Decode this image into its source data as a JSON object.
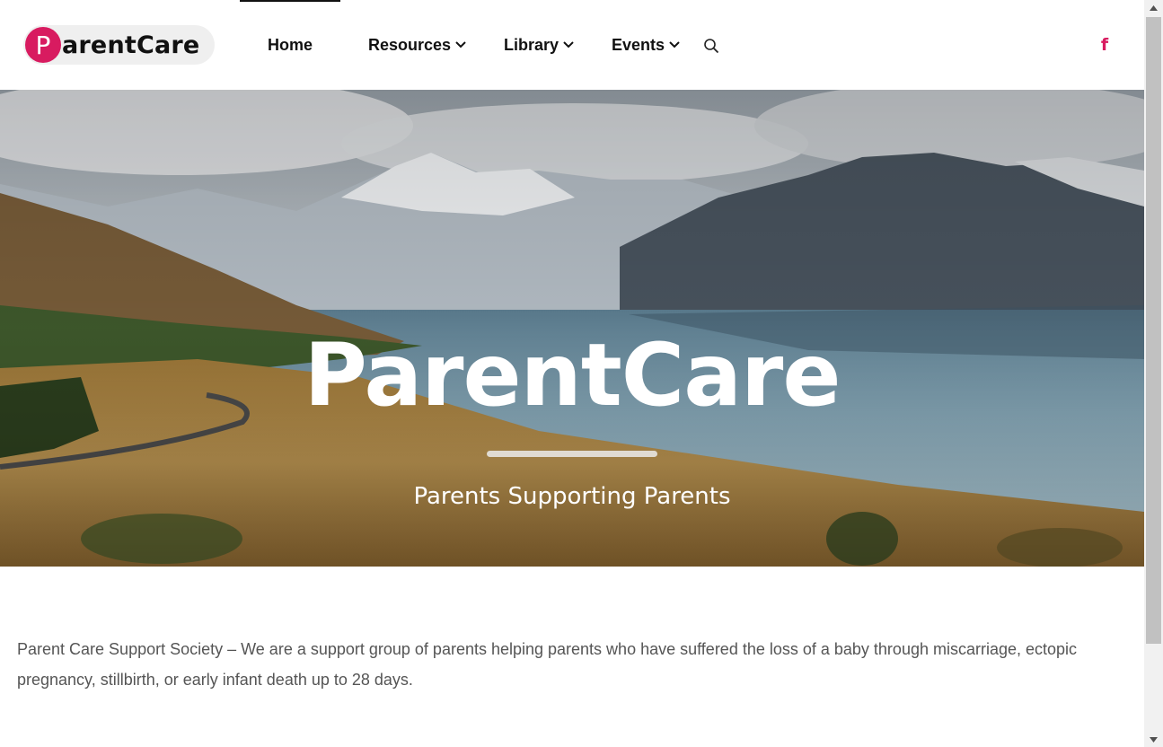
{
  "header": {
    "logo_letter": "P",
    "logo_text": "arentCare",
    "nav": [
      {
        "label": "Home"
      },
      {
        "label": "Resources"
      },
      {
        "label": "Library"
      },
      {
        "label": "Events"
      }
    ],
    "search_icon": "search-icon",
    "social_icon": "facebook-icon",
    "social_glyph": "f"
  },
  "hero": {
    "title": "ParentCare",
    "subtitle": "Parents Supporting Parents"
  },
  "intro": {
    "text": "Parent Care Support Society – We are a support group of parents helping parents who have suffered the loss of a baby through miscarriage, ectopic pregnancy, stillbirth, or early infant death up to 28 days."
  },
  "colors": {
    "brand": "#d81b60",
    "nav_text": "#111111",
    "body_text": "#555555"
  }
}
